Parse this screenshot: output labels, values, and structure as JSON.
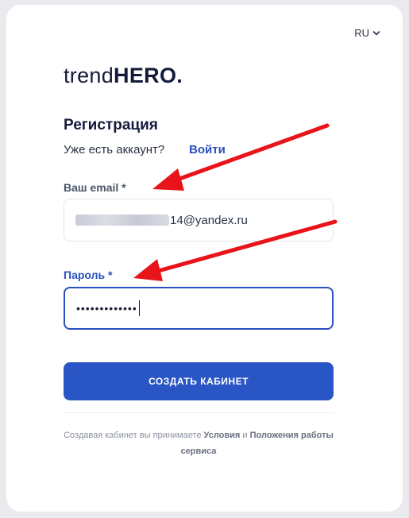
{
  "header": {
    "language": "RU",
    "logo_light": "trend",
    "logo_bold": "HERO."
  },
  "form": {
    "title": "Регистрация",
    "have_account": "Уже есть аккаунт?",
    "login_link": "Войти",
    "email_label": "Ваш email *",
    "email_value_visible": "14@yandex.ru",
    "password_label": "Пароль *",
    "password_masked": "•••••••••••••",
    "submit_label": "СОЗДАТЬ КАБИНЕТ"
  },
  "footer": {
    "terms_prefix": "Создавая кабинет вы принимаете",
    "terms_link1": "Условия",
    "terms_and": "и",
    "terms_link2": "Положения работы сервиса"
  },
  "colors": {
    "accent": "#2a55c4",
    "arrow": "#e8141a",
    "text_dark": "#141a3a"
  },
  "icons": {
    "language_dropdown": "chevron-down-icon",
    "annotation": "red-arrow"
  }
}
